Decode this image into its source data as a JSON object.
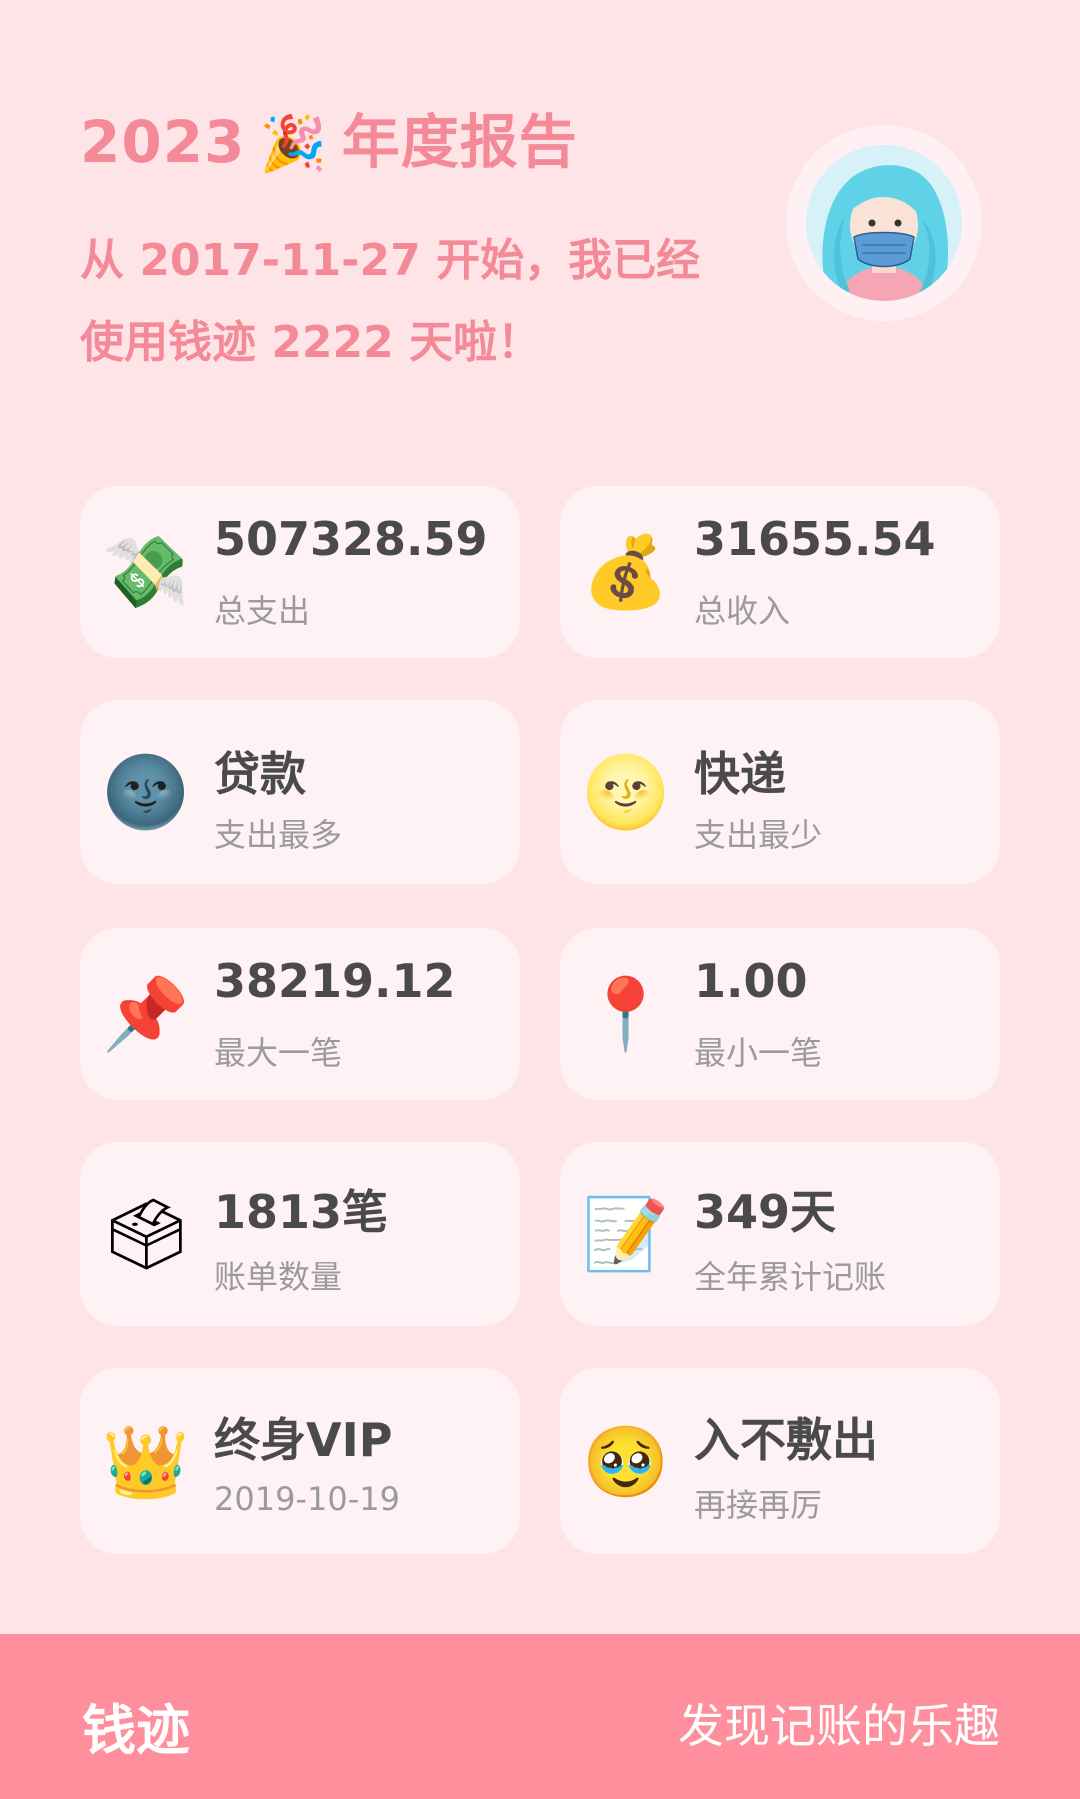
{
  "header": {
    "year": "2023",
    "party_icon": "🎉",
    "title_suffix": "年度报告",
    "subtitle": "从 2017-11-27 开始，我已经使用钱迹 2222 天啦！"
  },
  "stats": [
    {
      "icon_name": "money-with-wings-icon",
      "icon": "💸",
      "value": "507328.59",
      "label": "总支出"
    },
    {
      "icon_name": "money-bag-icon",
      "icon": "💰",
      "value": "31655.54",
      "label": "总收入"
    },
    {
      "icon_name": "new-moon-face-icon",
      "icon": "🌚",
      "value": "贷款",
      "label": "支出最多"
    },
    {
      "icon_name": "full-moon-face-icon",
      "icon": "🌝",
      "value": "快递",
      "label": "支出最少"
    },
    {
      "icon_name": "pushpin-icon",
      "icon": "📌",
      "value": "38219.12",
      "label": "最大一笔"
    },
    {
      "icon_name": "round-pushpin-icon",
      "icon": "📍",
      "value": "1.00",
      "label": "最小一笔"
    },
    {
      "icon_name": "ballot-box-icon",
      "icon": "🗳",
      "value": "1813笔",
      "label": "账单数量"
    },
    {
      "icon_name": "memo-icon",
      "icon": "📝",
      "value": "349天",
      "label": "全年累计记账"
    },
    {
      "icon_name": "crown-icon",
      "icon": "👑",
      "value": "终身VIP",
      "label": "2019-10-19"
    },
    {
      "icon_name": "pleading-face-icon",
      "icon": "🥹",
      "value": "入不敷出",
      "label": "再接再厉"
    }
  ],
  "footer": {
    "brand": "钱迹",
    "slogan": "发现记账的乐趣"
  },
  "colors": {
    "background": "#ffe4e7",
    "accent": "#f48a97",
    "card": "#fff2f4",
    "footer": "#ff8f9c"
  }
}
